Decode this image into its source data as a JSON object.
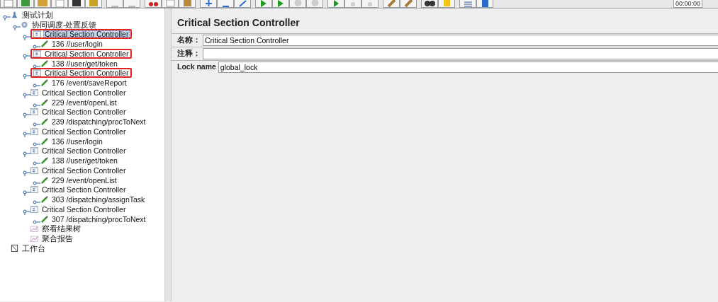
{
  "toolbar": {
    "timer": "00:00:00"
  },
  "tree": [
    {
      "label": "测试计划",
      "kind": "plan",
      "expanded": true,
      "selected": false,
      "children": [
        {
          "label": "协同调度-处置反馈",
          "kind": "thread_group",
          "expanded": true,
          "selected": false,
          "children": [
            {
              "label": "Critical Section Controller",
              "kind": "controller",
              "expanded": true,
              "selected": true,
              "highlighted": true,
              "children": [
                {
                  "label": "136 //user/login",
                  "kind": "sampler",
                  "selected": false
                }
              ]
            },
            {
              "label": "Critical Section Controller",
              "kind": "controller",
              "expanded": true,
              "selected": false,
              "highlighted": true,
              "children": [
                {
                  "label": "138 //user/get/token",
                  "kind": "sampler",
                  "selected": false
                }
              ]
            },
            {
              "label": "Critical Section Controller",
              "kind": "controller",
              "expanded": true,
              "selected": false,
              "highlighted": true,
              "children": [
                {
                  "label": "176 /event/saveReport",
                  "kind": "sampler",
                  "selected": false
                }
              ]
            },
            {
              "label": "Critical Section Controller",
              "kind": "controller",
              "expanded": true,
              "selected": false,
              "children": [
                {
                  "label": "229 /event/openList",
                  "kind": "sampler",
                  "selected": false
                }
              ]
            },
            {
              "label": "Critical Section Controller",
              "kind": "controller",
              "expanded": true,
              "selected": false,
              "children": [
                {
                  "label": "239 /dispatching/procToNext",
                  "kind": "sampler",
                  "selected": false
                }
              ]
            },
            {
              "label": "Critical Section Controller",
              "kind": "controller",
              "expanded": true,
              "selected": false,
              "children": [
                {
                  "label": "136 //user/login",
                  "kind": "sampler",
                  "selected": false
                }
              ]
            },
            {
              "label": "Critical Section Controller",
              "kind": "controller",
              "expanded": true,
              "selected": false,
              "children": [
                {
                  "label": "138 //user/get/token",
                  "kind": "sampler",
                  "selected": false
                }
              ]
            },
            {
              "label": "Critical Section Controller",
              "kind": "controller",
              "expanded": true,
              "selected": false,
              "children": [
                {
                  "label": "229 /event/openList",
                  "kind": "sampler",
                  "selected": false
                }
              ]
            },
            {
              "label": "Critical Section Controller",
              "kind": "controller",
              "expanded": true,
              "selected": false,
              "children": [
                {
                  "label": "303 /dispatching/assignTask",
                  "kind": "sampler",
                  "selected": false
                }
              ]
            },
            {
              "label": "Critical Section Controller",
              "kind": "controller",
              "expanded": true,
              "selected": false,
              "children": [
                {
                  "label": "307 /dispatching/procToNext",
                  "kind": "sampler",
                  "selected": false
                }
              ]
            },
            {
              "label": "察看结果树",
              "kind": "listener",
              "selected": false
            },
            {
              "label": "聚合报告",
              "kind": "listener",
              "selected": false
            }
          ]
        }
      ]
    },
    {
      "label": "工作台",
      "kind": "workbench",
      "selected": false
    }
  ],
  "panel": {
    "title": "Critical Section Controller",
    "fields": [
      {
        "label": "名称：",
        "value": "Critical Section Controller"
      },
      {
        "label": "注释："
      },
      {
        "label": "Lock name",
        "value": "global_lock"
      }
    ]
  }
}
